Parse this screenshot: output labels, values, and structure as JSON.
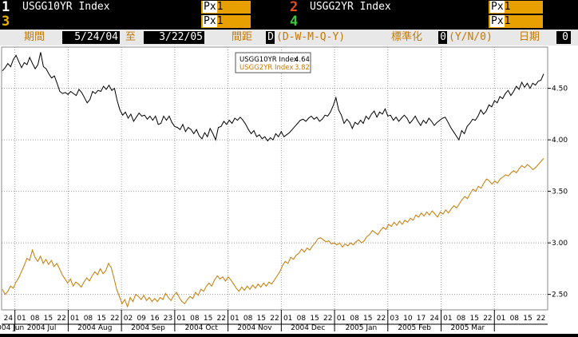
{
  "securities": [
    {
      "slot": "1",
      "slot_color": "#ffffff",
      "ticker": "USGG10YR Index",
      "field": "Px",
      "field_num": "1"
    },
    {
      "slot": "2",
      "slot_color": "#e8501e",
      "ticker": "USGG2YR Index",
      "field": "Px",
      "field_num": "1"
    },
    {
      "slot": "3",
      "slot_color": "#e8b400",
      "ticker": "",
      "field": "Px",
      "field_num": "1"
    },
    {
      "slot": "4",
      "slot_color": "#3cc83c",
      "ticker": "",
      "field": "Px",
      "field_num": "1"
    }
  ],
  "controls": {
    "period_label": "期間",
    "start_date": "5/24/04",
    "to_label": "至",
    "end_date": "3/22/05",
    "interval_label": "間距",
    "interval_value": "D",
    "interval_options": "(D-W-M-Q-Y)",
    "normalize_label": "標準化",
    "normalize_value": "0",
    "normalize_options": "(Y/N/0)",
    "date_label": "日期",
    "date_value": "0"
  },
  "legend": [
    {
      "name": "USGG10YR Index",
      "value": "4.64",
      "color": "#000000"
    },
    {
      "name": "USGG2YR Index",
      "value": "3.82",
      "color": "#c87800"
    }
  ],
  "chart_data": {
    "type": "line",
    "ylim": [
      2.35,
      4.9
    ],
    "y_ticks": [
      "2.50",
      "3.00",
      "3.50",
      "4.00",
      "4.50"
    ],
    "grid": true,
    "x_day_labels": [
      "24",
      "01",
      "08",
      "15",
      "22",
      "01",
      "08",
      "15",
      "22",
      "02",
      "09",
      "16",
      "23",
      "01",
      "08",
      "15",
      "22",
      "01",
      "08",
      "15",
      "22",
      "01",
      "08",
      "15",
      "22",
      "01",
      "08",
      "15",
      "22",
      "03",
      "10",
      "17",
      "24",
      "01",
      "08",
      "15",
      "22",
      "01",
      "08",
      "15",
      "22"
    ],
    "x_month_labels": [
      "2004 Jun",
      "2004 Jul",
      "2004 Aug",
      "2004 Sep",
      "2004 Oct",
      "2004 Nov",
      "2004 Dec",
      "2005 Jan",
      "2005 Feb",
      "2005 Mar"
    ],
    "series": [
      {
        "name": "USGG10YR Index",
        "color": "#000000",
        "values": [
          4.67,
          4.7,
          4.74,
          4.71,
          4.78,
          4.82,
          4.76,
          4.7,
          4.75,
          4.73,
          4.8,
          4.74,
          4.69,
          4.73,
          4.85,
          4.71,
          4.69,
          4.64,
          4.6,
          4.62,
          4.55,
          4.47,
          4.45,
          4.46,
          4.44,
          4.47,
          4.45,
          4.43,
          4.49,
          4.46,
          4.41,
          4.36,
          4.39,
          4.47,
          4.45,
          4.48,
          4.47,
          4.52,
          4.49,
          4.53,
          4.48,
          4.5,
          4.38,
          4.29,
          4.24,
          4.27,
          4.21,
          4.25,
          4.18,
          4.22,
          4.26,
          4.23,
          4.24,
          4.2,
          4.23,
          4.19,
          4.23,
          4.15,
          4.16,
          4.23,
          4.19,
          4.23,
          4.17,
          4.13,
          4.12,
          4.1,
          4.15,
          4.08,
          4.12,
          4.1,
          4.06,
          4.1,
          4.04,
          4.01,
          4.07,
          4.03,
          4.11,
          4.06,
          4.0,
          4.12,
          4.13,
          4.18,
          4.15,
          4.19,
          4.16,
          4.21,
          4.19,
          4.22,
          4.19,
          4.15,
          4.1,
          4.06,
          4.09,
          4.03,
          4.05,
          4.01,
          4.03,
          3.99,
          4.02,
          4.0,
          4.06,
          4.03,
          4.08,
          4.03,
          4.05,
          4.07,
          4.1,
          4.13,
          4.16,
          4.19,
          4.2,
          4.18,
          4.21,
          4.23,
          4.2,
          4.22,
          4.18,
          4.2,
          4.24,
          4.23,
          4.27,
          4.33,
          4.41,
          4.29,
          4.24,
          4.16,
          4.2,
          4.17,
          4.11,
          4.17,
          4.15,
          4.19,
          4.16,
          4.23,
          4.2,
          4.25,
          4.28,
          4.22,
          4.27,
          4.25,
          4.3,
          4.23,
          4.24,
          4.19,
          4.22,
          4.18,
          4.21,
          4.24,
          4.21,
          4.16,
          4.19,
          4.23,
          4.18,
          4.14,
          4.19,
          4.16,
          4.21,
          4.18,
          4.14,
          4.17,
          4.19,
          4.21,
          4.22,
          4.17,
          4.12,
          4.08,
          4.04,
          4.0,
          4.09,
          4.06,
          4.13,
          4.16,
          4.2,
          4.19,
          4.23,
          4.29,
          4.25,
          4.28,
          4.34,
          4.32,
          4.38,
          4.36,
          4.42,
          4.4,
          4.45,
          4.48,
          4.43,
          4.47,
          4.52,
          4.49,
          4.56,
          4.51,
          4.55,
          4.5,
          4.55,
          4.53,
          4.57,
          4.58,
          4.64
        ]
      },
      {
        "name": "USGG2YR Index",
        "color": "#c87800",
        "values": [
          2.55,
          2.5,
          2.53,
          2.58,
          2.56,
          2.62,
          2.66,
          2.72,
          2.78,
          2.85,
          2.83,
          2.93,
          2.86,
          2.82,
          2.87,
          2.8,
          2.84,
          2.79,
          2.83,
          2.77,
          2.8,
          2.75,
          2.69,
          2.65,
          2.61,
          2.65,
          2.58,
          2.62,
          2.6,
          2.57,
          2.62,
          2.66,
          2.63,
          2.68,
          2.72,
          2.69,
          2.75,
          2.7,
          2.73,
          2.8,
          2.76,
          2.66,
          2.55,
          2.48,
          2.41,
          2.45,
          2.38,
          2.47,
          2.43,
          2.5,
          2.48,
          2.45,
          2.49,
          2.44,
          2.47,
          2.43,
          2.46,
          2.43,
          2.47,
          2.45,
          2.51,
          2.47,
          2.44,
          2.49,
          2.52,
          2.47,
          2.43,
          2.41,
          2.45,
          2.48,
          2.46,
          2.52,
          2.49,
          2.55,
          2.53,
          2.58,
          2.61,
          2.58,
          2.64,
          2.68,
          2.65,
          2.67,
          2.63,
          2.67,
          2.64,
          2.6,
          2.56,
          2.53,
          2.57,
          2.54,
          2.58,
          2.55,
          2.59,
          2.56,
          2.6,
          2.57,
          2.61,
          2.58,
          2.62,
          2.6,
          2.64,
          2.68,
          2.72,
          2.78,
          2.82,
          2.8,
          2.86,
          2.84,
          2.88,
          2.9,
          2.94,
          2.91,
          2.95,
          2.93,
          2.97,
          3.0,
          3.04,
          3.05,
          3.03,
          3.01,
          3.02,
          2.99,
          3.0,
          2.98,
          3.0,
          2.96,
          2.99,
          2.97,
          3.0,
          2.98,
          3.01,
          3.03,
          3.0,
          3.02,
          3.06,
          3.08,
          3.12,
          3.1,
          3.08,
          3.12,
          3.15,
          3.13,
          3.18,
          3.16,
          3.2,
          3.17,
          3.21,
          3.18,
          3.22,
          3.2,
          3.24,
          3.22,
          3.27,
          3.25,
          3.29,
          3.26,
          3.3,
          3.27,
          3.31,
          3.28,
          3.25,
          3.3,
          3.28,
          3.32,
          3.29,
          3.33,
          3.36,
          3.34,
          3.38,
          3.42,
          3.45,
          3.43,
          3.48,
          3.52,
          3.5,
          3.55,
          3.53,
          3.58,
          3.62,
          3.6,
          3.57,
          3.6,
          3.58,
          3.62,
          3.64,
          3.66,
          3.65,
          3.68,
          3.7,
          3.68,
          3.72,
          3.75,
          3.73,
          3.76,
          3.74,
          3.71,
          3.73,
          3.76,
          3.79,
          3.82
        ]
      }
    ]
  }
}
